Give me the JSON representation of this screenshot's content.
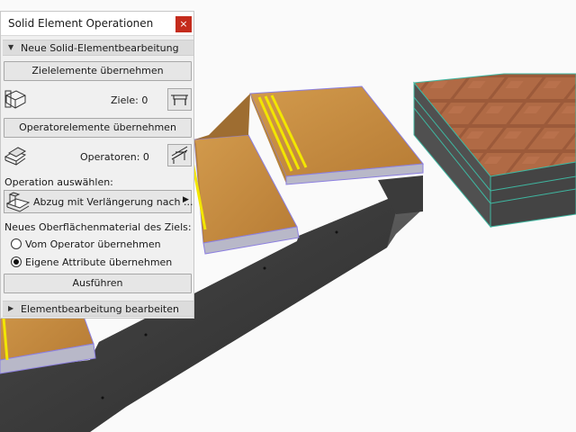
{
  "panel": {
    "title": "Solid Element Operationen",
    "close_symbol": "×",
    "section_new": "Neue Solid-Elementbearbeitung",
    "get_targets_button": "Zielelemente übernehmen",
    "targets_label": "Ziele: 0",
    "get_operators_button": "Operatorelemente übernehmen",
    "operators_label": "Operatoren: 0",
    "operation_label": "Operation auswählen:",
    "operation_value": "Abzug mit Verlängerung nach ...",
    "material_label": "Neues Oberflächenmaterial des Ziels:",
    "radio_options": [
      {
        "label": "Vom Operator übernehmen",
        "selected": false
      },
      {
        "label": "Eigene Attribute übernehmen",
        "selected": true
      }
    ],
    "execute_button": "Ausführen",
    "section_edit": "Elementbearbeitung bearbeiten"
  },
  "icons": {
    "close": "close-icon",
    "target_body": "target-body-icon",
    "target_pick": "pick-target-icon",
    "operator_body": "operator-body-icon",
    "operator_pick": "pick-operator-icon",
    "operation": "subtraction-upward-icon",
    "expand": "triangle-down-icon",
    "collapse": "triangle-right-icon",
    "dropdown_arrow": "chevron-right-icon"
  },
  "colors": {
    "close_button": "#c42b1c",
    "selection_outline": "#8c7fe0",
    "stair_nosing": "#f2e600",
    "wood": "#c8903f"
  }
}
